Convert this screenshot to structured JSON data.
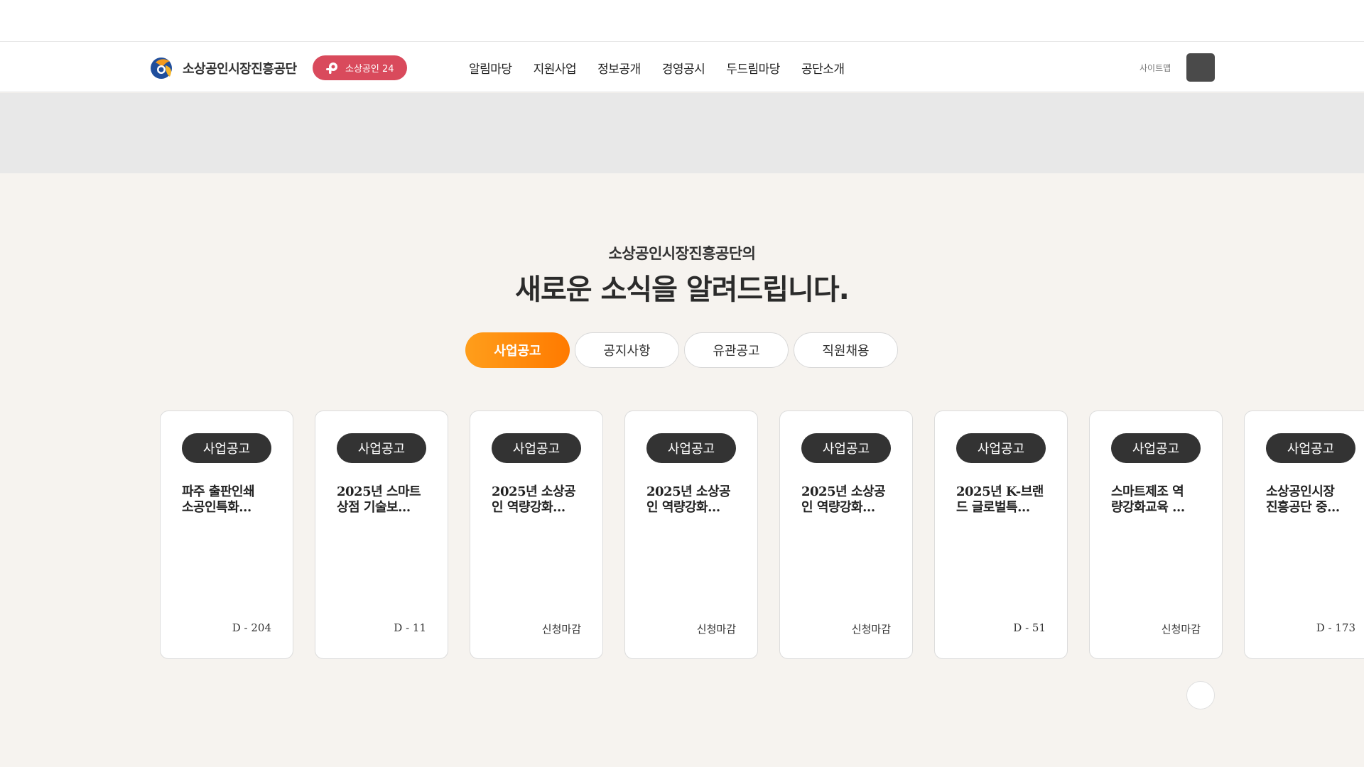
{
  "header": {
    "logo_text": "소상공인시장진흥공단",
    "pill_label": "소상공인 24",
    "nav": [
      "알림마당",
      "지원사업",
      "정보공개",
      "경영공시",
      "두드림마당",
      "공단소개"
    ],
    "sitemap": "사이트맵",
    "menu_icon": "hamburger-icon"
  },
  "hero": {
    "subtitle": "소상공인시장진흥공단의",
    "title": "새로운 소식을 알려드립니다."
  },
  "tabs": [
    {
      "label": "사업공고",
      "active": true
    },
    {
      "label": "공지사항",
      "active": false
    },
    {
      "label": "유관공고",
      "active": false
    },
    {
      "label": "직원채용",
      "active": false
    }
  ],
  "cards": [
    {
      "badge": "사업공고",
      "title_line1": "파주 출판인쇄",
      "title_line2": "소공인특화…",
      "status": "D - 204"
    },
    {
      "badge": "사업공고",
      "title_line1": "2025년 스마트",
      "title_line2": "상점 기술보…",
      "status": "D - 11"
    },
    {
      "badge": "사업공고",
      "title_line1": "2025년 소상공",
      "title_line2": "인 역량강화…",
      "status": "신청마감"
    },
    {
      "badge": "사업공고",
      "title_line1": "2025년 소상공",
      "title_line2": "인 역량강화…",
      "status": "신청마감"
    },
    {
      "badge": "사업공고",
      "title_line1": "2025년 소상공",
      "title_line2": "인 역량강화…",
      "status": "신청마감"
    },
    {
      "badge": "사업공고",
      "title_line1": "2025년 K-브랜",
      "title_line2": "드 글로벌특…",
      "status": "D - 51"
    },
    {
      "badge": "사업공고",
      "title_line1": "스마트제조 역",
      "title_line2": "량강화교육 …",
      "status": "신청마감"
    },
    {
      "badge": "사업공고",
      "title_line1": "소상공인시장",
      "title_line2": "진흥공단 중…",
      "status": "D - 173"
    }
  ],
  "colors": {
    "accent_orange": "#ff8a00",
    "pill_red": "#d94a5c",
    "badge_dark": "#333333",
    "page_bg": "#f6f3ef"
  }
}
